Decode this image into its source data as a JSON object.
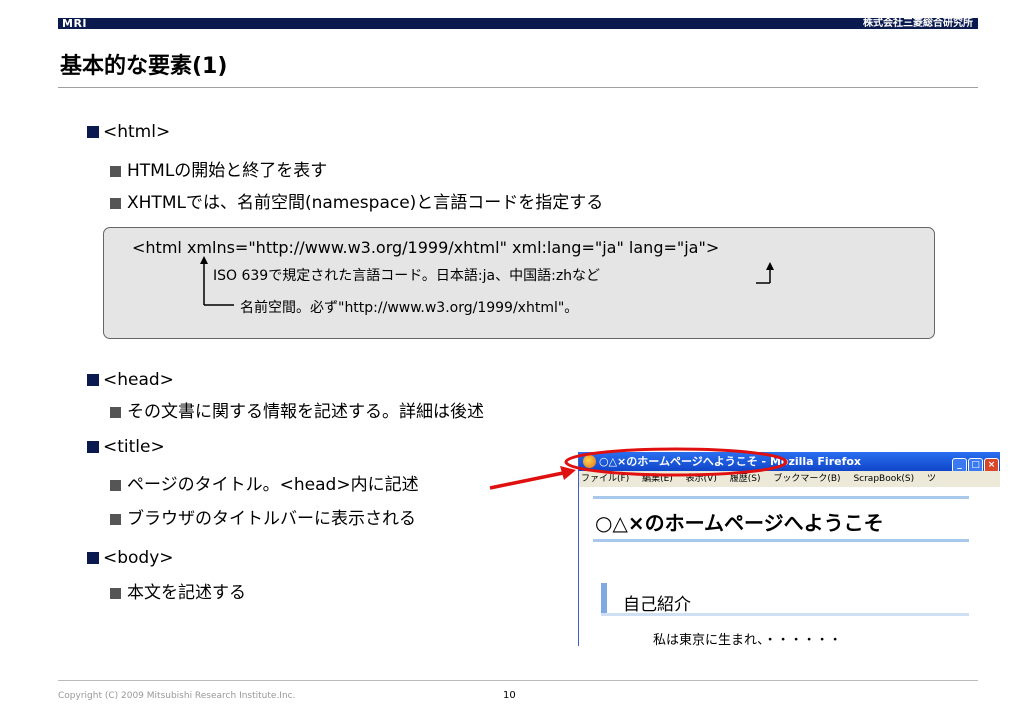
{
  "header": {
    "logo": "MRI",
    "company": "株式会社三菱総合研究所",
    "title": "基本的な要素(1)"
  },
  "sections": {
    "html": {
      "tag": "<html>",
      "items": [
        "HTMLの開始と終了を表す",
        "XHTMLでは、名前空間(namespace)と言語コードを指定する"
      ]
    },
    "code_example": {
      "code": "<html xmlns=\"http://www.w3.org/1999/xhtml\" xml:lang=\"ja\" lang=\"ja\">",
      "note_lang": "ISO 639で規定された言語コード。日本語:ja、中国語:zhなど",
      "note_ns": "名前空間。必ず\"http://www.w3.org/1999/xhtml\"。"
    },
    "head": {
      "tag": "<head>",
      "items": [
        "その文書に関する情報を記述する。詳細は後述"
      ]
    },
    "title": {
      "tag": "<title>",
      "items": [
        "ページのタイトル。<head>内に記述",
        "ブラウザのタイトルバーに表示される"
      ]
    },
    "body": {
      "tag": "<body>",
      "items": [
        "本文を記述する"
      ]
    }
  },
  "browser": {
    "title": "○△×のホームページへようこそ - Mozilla Firefox",
    "menu": [
      "ファイル(F)",
      "編集(E)",
      "表示(V)",
      "履歴(S)",
      "ブックマーク(B)",
      "ScrapBook(S)",
      "ツ"
    ],
    "h1": "○△×のホームページへようこそ",
    "h2": "自己紹介",
    "paragraph": "私は東京に生まれ、・・・・・・",
    "highlight_color": "#e01010"
  },
  "footer": {
    "copyright": "Copyright (C) 2009 Mitsubishi Research Institute.Inc.",
    "page": "10"
  }
}
